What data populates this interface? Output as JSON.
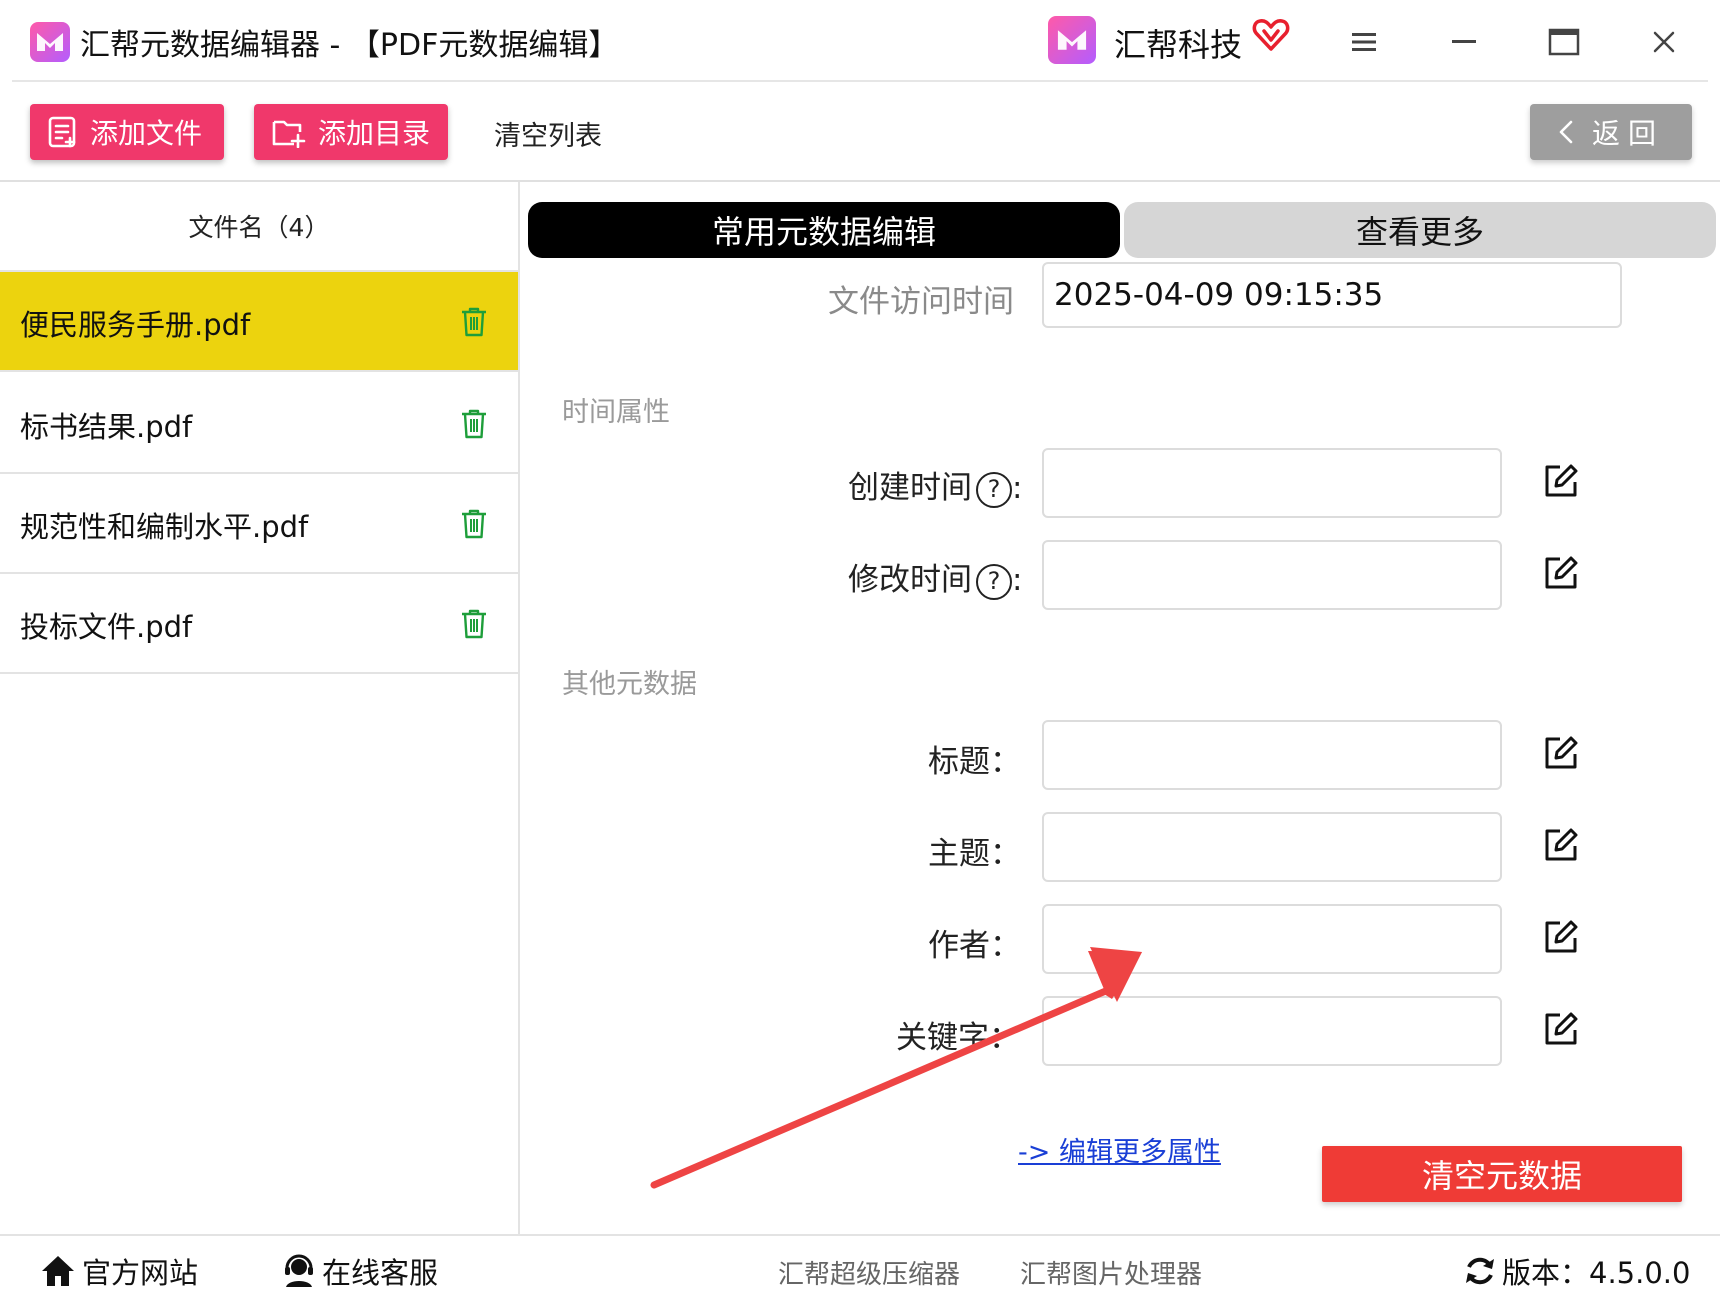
{
  "window": {
    "title": "汇帮元数据编辑器 - 【PDF元数据编辑】",
    "brand": "汇帮科技",
    "icons": [
      "app-logo-icon",
      "brand-logo-icon",
      "vip-heart-icon",
      "menu-icon",
      "minimize-icon",
      "maximize-icon",
      "close-icon"
    ]
  },
  "toolbar": {
    "add_file": "添加文件",
    "add_dir": "添加目录",
    "clear_list": "清空列表",
    "back": "返回"
  },
  "file_list": {
    "header": "文件名（4）",
    "files": [
      {
        "name": "便民服务手册.pdf",
        "selected": true
      },
      {
        "name": "标书结果.pdf",
        "selected": false
      },
      {
        "name": "规范性和编制水平.pdf",
        "selected": false
      },
      {
        "name": "投标文件.pdf",
        "selected": false
      }
    ]
  },
  "tabs": {
    "active": "常用元数据编辑",
    "more": "查看更多"
  },
  "access_time": {
    "label": "文件访问时间",
    "value": "2025-04-09 09:15:35"
  },
  "time_section": {
    "title": "时间属性",
    "created_label": "创建时间",
    "modified_label": "修改时间",
    "help_glyph": "?",
    "created_value": "",
    "modified_value": ""
  },
  "other_section": {
    "title": "其他元数据",
    "title_label": "标题：",
    "subject_label": "主题：",
    "author_label": "作者：",
    "keywords_label": "关键字：",
    "title_value": "",
    "subject_value": "",
    "author_value": "",
    "keywords_value": ""
  },
  "actions": {
    "more_link": "-> 编辑更多属性",
    "clear_meta": "清空元数据"
  },
  "annotation": {
    "color": "#ee4444"
  },
  "statusbar": {
    "website": "官方网站",
    "service": "在线客服",
    "compressor": "汇帮超级压缩器",
    "image_tool": "汇帮图片处理器",
    "version": "版本：4.5.0.0"
  },
  "colors": {
    "accent_pink": "#f0386b",
    "selected_row": "#ecd30e",
    "danger": "#ef3b36",
    "trash_green": "#1e9e3a"
  }
}
